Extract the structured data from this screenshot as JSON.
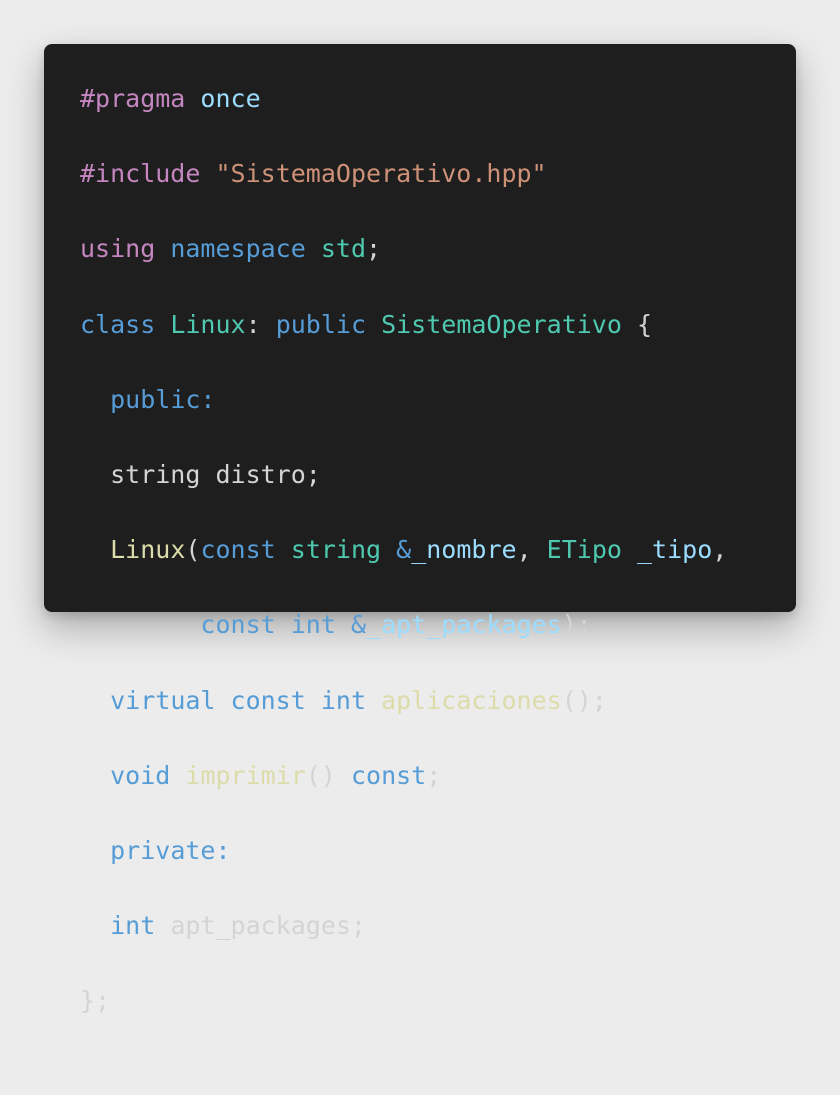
{
  "code": {
    "colors": {
      "background": "#1e1e1e",
      "macro": "#c586c0",
      "keyword": "#569cd6",
      "string": "#ce9178",
      "type": "#4ec9b0",
      "function": "#dcdcaa",
      "parameter": "#9cdcfe",
      "plain": "#d4d4d4"
    },
    "lines": [
      [
        {
          "text": "#pragma",
          "kind": "macro"
        },
        {
          "text": " ",
          "kind": "plain"
        },
        {
          "text": "once",
          "kind": "param"
        }
      ],
      [
        {
          "text": "#include",
          "kind": "macro"
        },
        {
          "text": " ",
          "kind": "plain"
        },
        {
          "text": "\"SistemaOperativo.hpp\"",
          "kind": "string"
        }
      ],
      [
        {
          "text": "using",
          "kind": "macro"
        },
        {
          "text": " ",
          "kind": "plain"
        },
        {
          "text": "namespace",
          "kind": "keyword"
        },
        {
          "text": " ",
          "kind": "plain"
        },
        {
          "text": "std",
          "kind": "type"
        },
        {
          "text": ";",
          "kind": "plain"
        }
      ],
      [
        {
          "text": "class",
          "kind": "keyword"
        },
        {
          "text": " ",
          "kind": "plain"
        },
        {
          "text": "Linux",
          "kind": "type"
        },
        {
          "text": ": ",
          "kind": "plain"
        },
        {
          "text": "public",
          "kind": "keyword"
        },
        {
          "text": " ",
          "kind": "plain"
        },
        {
          "text": "SistemaOperativo",
          "kind": "type"
        },
        {
          "text": " {",
          "kind": "plain"
        }
      ],
      [
        {
          "text": "  ",
          "kind": "plain"
        },
        {
          "text": "public:",
          "kind": "keyword"
        }
      ],
      [
        {
          "text": "  string distro;",
          "kind": "plain"
        }
      ],
      [
        {
          "text": "  ",
          "kind": "plain"
        },
        {
          "text": "Linux",
          "kind": "func"
        },
        {
          "text": "(",
          "kind": "plain"
        },
        {
          "text": "const",
          "kind": "keyword"
        },
        {
          "text": " ",
          "kind": "plain"
        },
        {
          "text": "string",
          "kind": "type"
        },
        {
          "text": " ",
          "kind": "plain"
        },
        {
          "text": "&",
          "kind": "keyword"
        },
        {
          "text": "_nombre",
          "kind": "param"
        },
        {
          "text": ", ",
          "kind": "plain"
        },
        {
          "text": "ETipo",
          "kind": "type"
        },
        {
          "text": " ",
          "kind": "plain"
        },
        {
          "text": "_tipo",
          "kind": "param"
        },
        {
          "text": ",",
          "kind": "plain"
        }
      ],
      [
        {
          "text": "        ",
          "kind": "plain"
        },
        {
          "text": "const",
          "kind": "keyword"
        },
        {
          "text": " ",
          "kind": "plain"
        },
        {
          "text": "int",
          "kind": "keyword"
        },
        {
          "text": " ",
          "kind": "plain"
        },
        {
          "text": "&",
          "kind": "keyword"
        },
        {
          "text": "_apt_packages",
          "kind": "param"
        },
        {
          "text": ");",
          "kind": "plain"
        }
      ],
      [
        {
          "text": "  ",
          "kind": "plain"
        },
        {
          "text": "virtual",
          "kind": "keyword"
        },
        {
          "text": " ",
          "kind": "plain"
        },
        {
          "text": "const",
          "kind": "keyword"
        },
        {
          "text": " ",
          "kind": "plain"
        },
        {
          "text": "int",
          "kind": "keyword"
        },
        {
          "text": " ",
          "kind": "plain"
        },
        {
          "text": "aplicaciones",
          "kind": "func"
        },
        {
          "text": "();",
          "kind": "plain"
        }
      ],
      [
        {
          "text": "  ",
          "kind": "plain"
        },
        {
          "text": "void",
          "kind": "keyword"
        },
        {
          "text": " ",
          "kind": "plain"
        },
        {
          "text": "imprimir",
          "kind": "func"
        },
        {
          "text": "() ",
          "kind": "plain"
        },
        {
          "text": "const",
          "kind": "keyword"
        },
        {
          "text": ";",
          "kind": "plain"
        }
      ],
      [
        {
          "text": "  ",
          "kind": "plain"
        },
        {
          "text": "private:",
          "kind": "keyword"
        }
      ],
      [
        {
          "text": "  ",
          "kind": "plain"
        },
        {
          "text": "int",
          "kind": "keyword"
        },
        {
          "text": " apt_packages;",
          "kind": "plain"
        }
      ],
      [
        {
          "text": "};",
          "kind": "plain"
        }
      ]
    ]
  }
}
